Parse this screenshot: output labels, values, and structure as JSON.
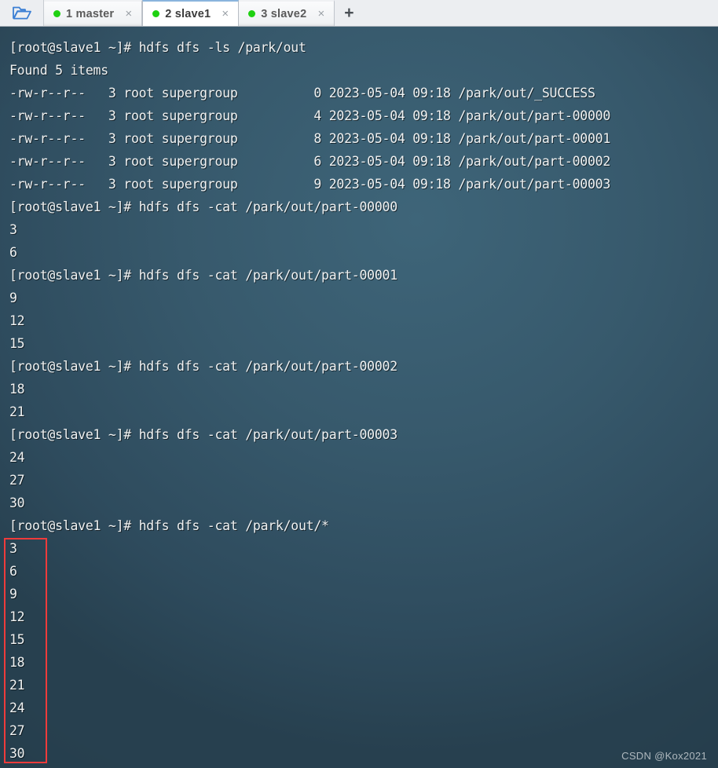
{
  "window": {
    "app_kind": "terminal-emulator",
    "folder_icon": "open-folder-icon",
    "new_tab_label": "+"
  },
  "tabs": [
    {
      "label": "1 master",
      "status_dot_color": "#1fd111",
      "close_label": "×",
      "active": false
    },
    {
      "label": "2 slave1",
      "status_dot_color": "#1fd111",
      "close_label": "×",
      "active": true
    },
    {
      "label": "3 slave2",
      "status_dot_color": "#1fd111",
      "close_label": "×",
      "active": false
    }
  ],
  "terminal": {
    "prompt": "[root@slave1 ~]#",
    "background_color": "#35586b",
    "text_color": "#f0f2f2",
    "lines": [
      "[root@slave1 ~]# hdfs dfs -ls /park/out",
      "Found 5 items",
      "-rw-r--r--   3 root supergroup          0 2023-05-04 09:18 /park/out/_SUCCESS",
      "-rw-r--r--   3 root supergroup          4 2023-05-04 09:18 /park/out/part-00000",
      "-rw-r--r--   3 root supergroup          8 2023-05-04 09:18 /park/out/part-00001",
      "-rw-r--r--   3 root supergroup          6 2023-05-04 09:18 /park/out/part-00002",
      "-rw-r--r--   3 root supergroup          9 2023-05-04 09:18 /park/out/part-00003",
      "[root@slave1 ~]# hdfs dfs -cat /park/out/part-00000",
      "3",
      "6",
      "[root@slave1 ~]# hdfs dfs -cat /park/out/part-00001",
      "9",
      "12",
      "15",
      "[root@slave1 ~]# hdfs dfs -cat /park/out/part-00002",
      "18",
      "21",
      "[root@slave1 ~]# hdfs dfs -cat /park/out/part-00003",
      "24",
      "27",
      "30",
      "[root@slave1 ~]# hdfs dfs -cat /park/out/*",
      "3",
      "6",
      "9",
      "12",
      "15",
      "18",
      "21",
      "24",
      "27",
      "30"
    ],
    "commands": [
      "hdfs dfs -ls /park/out",
      "hdfs dfs -cat /park/out/part-00000",
      "hdfs dfs -cat /park/out/part-00001",
      "hdfs dfs -cat /park/out/part-00002",
      "hdfs dfs -cat /park/out/part-00003",
      "hdfs dfs -cat /park/out/*"
    ],
    "listing": {
      "header": "Found 5 items",
      "rows": [
        {
          "perms": "-rw-r--r--",
          "replication": "3",
          "owner": "root",
          "group": "supergroup",
          "size": "0",
          "date": "2023-05-04",
          "time": "09:18",
          "path": "/park/out/_SUCCESS"
        },
        {
          "perms": "-rw-r--r--",
          "replication": "3",
          "owner": "root",
          "group": "supergroup",
          "size": "4",
          "date": "2023-05-04",
          "time": "09:18",
          "path": "/park/out/part-00000"
        },
        {
          "perms": "-rw-r--r--",
          "replication": "3",
          "owner": "root",
          "group": "supergroup",
          "size": "8",
          "date": "2023-05-04",
          "time": "09:18",
          "path": "/park/out/part-00001"
        },
        {
          "perms": "-rw-r--r--",
          "replication": "3",
          "owner": "root",
          "group": "supergroup",
          "size": "6",
          "date": "2023-05-04",
          "time": "09:18",
          "path": "/park/out/part-00002"
        },
        {
          "perms": "-rw-r--r--",
          "replication": "3",
          "owner": "root",
          "group": "supergroup",
          "size": "9",
          "date": "2023-05-04",
          "time": "09:18",
          "path": "/park/out/part-00003"
        }
      ]
    },
    "cat_outputs": {
      "part-00000": [
        "3",
        "6"
      ],
      "part-00001": [
        "9",
        "12",
        "15"
      ],
      "part-00002": [
        "18",
        "21"
      ],
      "part-00003": [
        "24",
        "27",
        "30"
      ],
      "all": [
        "3",
        "6",
        "9",
        "12",
        "15",
        "18",
        "21",
        "24",
        "27",
        "30"
      ]
    }
  },
  "annotation": {
    "highlight_box_color": "#ef3b3b"
  },
  "watermark": {
    "text": "CSDN @Kox2021"
  }
}
